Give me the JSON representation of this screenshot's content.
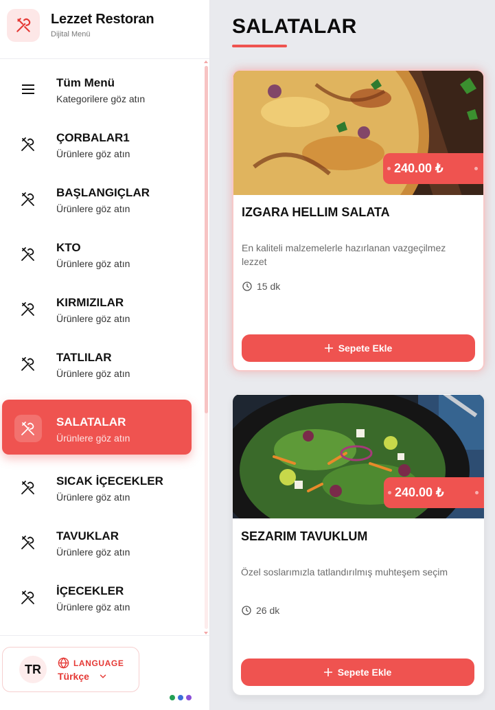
{
  "brand": {
    "title": "Lezzet Restoran",
    "subtitle": "Dijital Menü"
  },
  "menu": {
    "items": [
      {
        "title": "Tüm Menü",
        "subtitle": "Kategorilere göz atın",
        "icon": "hamburger-menu-icon",
        "active": false
      },
      {
        "title": "ÇORBALAR1",
        "subtitle": "Ürünlere göz atın",
        "icon": "utensils-icon",
        "active": false
      },
      {
        "title": "BAŞLANGIÇLAR",
        "subtitle": "Ürünlere göz atın",
        "icon": "utensils-icon",
        "active": false
      },
      {
        "title": "KTO",
        "subtitle": "Ürünlere göz atın",
        "icon": "utensils-icon",
        "active": false
      },
      {
        "title": "KIRMIZILAR",
        "subtitle": "Ürünlere göz atın",
        "icon": "utensils-icon",
        "active": false
      },
      {
        "title": "TATLILAR",
        "subtitle": "Ürünlere göz atın",
        "icon": "utensils-icon",
        "active": false
      },
      {
        "title": "SALATALAR",
        "subtitle": "Ürünlere göz atın",
        "icon": "utensils-icon",
        "active": true
      },
      {
        "title": "SICAK İÇECEKLER",
        "subtitle": "Ürünlere göz atın",
        "icon": "utensils-icon",
        "active": false
      },
      {
        "title": "TAVUKLAR",
        "subtitle": "Ürünlere göz atın",
        "icon": "utensils-icon",
        "active": false
      },
      {
        "title": "İÇECEKLER",
        "subtitle": "Ürünlere göz atın",
        "icon": "utensils-icon",
        "active": false
      }
    ]
  },
  "language": {
    "code": "TR",
    "label": "LANGUAGE",
    "value": "Türkçe",
    "dots": [
      "#22a055",
      "#3b6fd8",
      "#8b4fd8"
    ]
  },
  "main": {
    "title": "SALATALAR",
    "products": [
      {
        "name": "IZGARA HELLIM SALATA",
        "price": "240.00 ₺",
        "description": "En kaliteli malzemelerle hazırlanan vazgeçilmez lezzet",
        "time": "15 dk",
        "button": "Sepete Ekle"
      },
      {
        "name": "SEZARIM TAVUKLUM",
        "price": "240.00 ₺",
        "description": "Özel soslarımızla tatlandırılmış muhteşem seçim",
        "time": "26 dk",
        "button": "Sepete Ekle"
      }
    ]
  },
  "colors": {
    "accent": "#ef5350",
    "accent_light": "#fde7e7",
    "background": "#e9eaee"
  }
}
